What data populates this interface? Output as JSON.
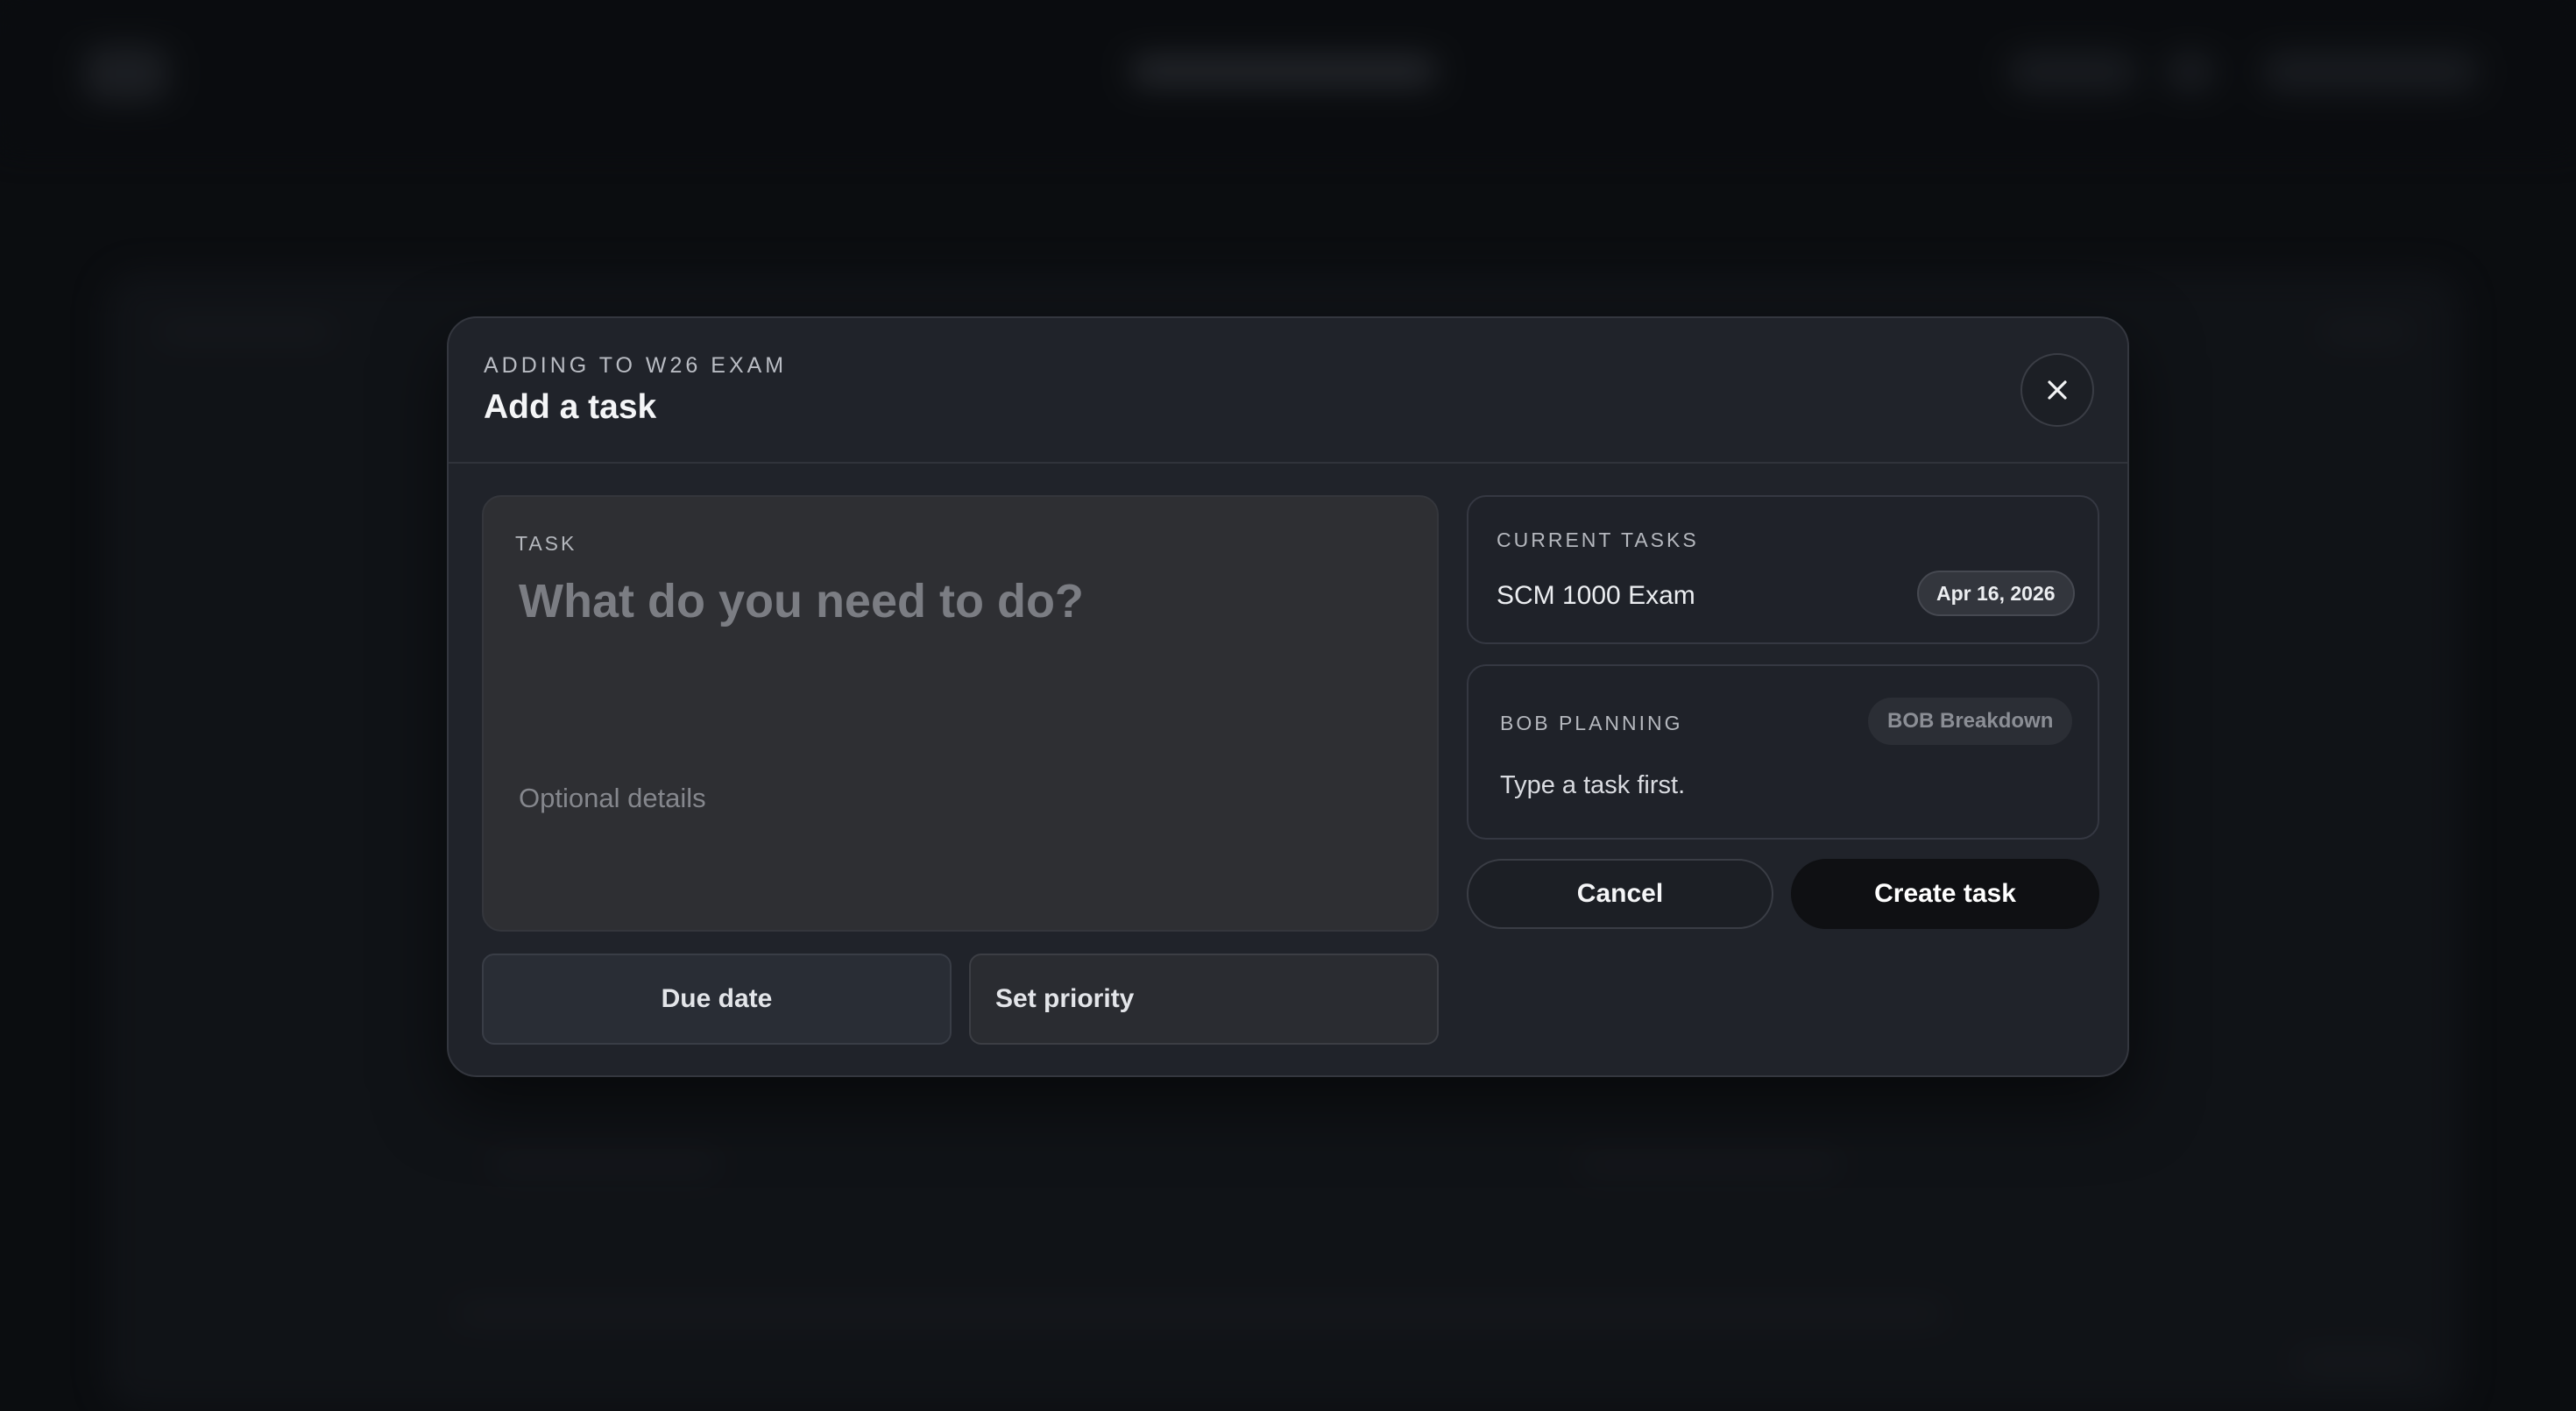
{
  "modal": {
    "eyebrow": "ADDING TO W26 EXAM",
    "title": "Add a task",
    "close_icon": "close-icon"
  },
  "task_editor": {
    "label": "TASK",
    "title_placeholder": "What do you need to do?",
    "details_placeholder": "Optional details"
  },
  "options": {
    "due_date_label": "Due date",
    "priority_label": "Set priority"
  },
  "current_tasks": {
    "heading": "CURRENT TASKS",
    "items": [
      {
        "name": "SCM 1000 Exam",
        "date": "Apr 16, 2026"
      }
    ]
  },
  "bob_planning": {
    "heading": "BOB PLANNING",
    "badge": "BOB Breakdown",
    "hint": "Type a task first."
  },
  "actions": {
    "cancel_label": "Cancel",
    "create_label": "Create task"
  },
  "colors": {
    "background": "#0b0d10",
    "modal": "#20232a",
    "task_card": "#2e2f33",
    "create_button": "#0f1013"
  }
}
